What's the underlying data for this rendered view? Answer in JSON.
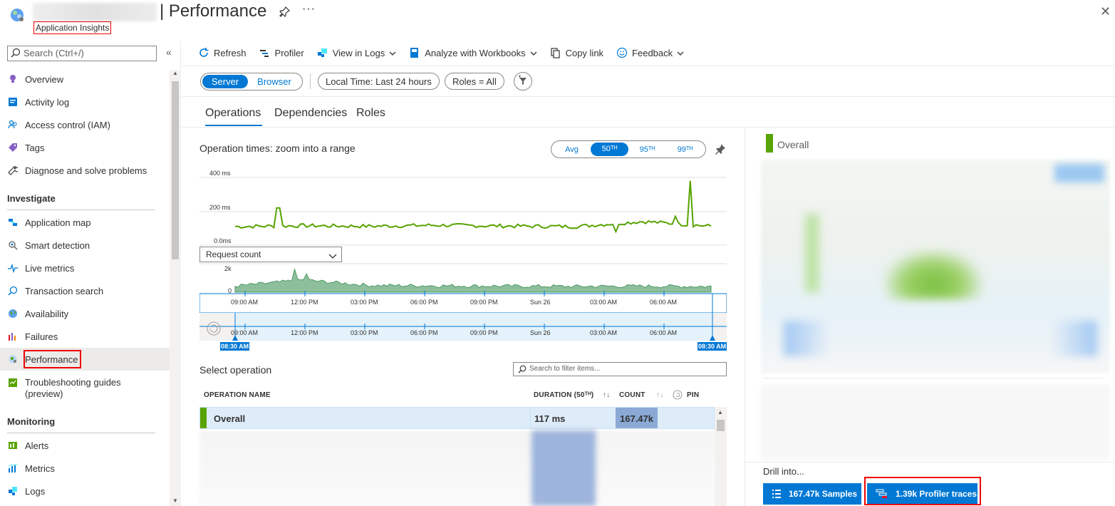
{
  "header": {
    "title": "| Performance",
    "subtitle": "Application Insights",
    "more_label": "···",
    "close_label": "✕"
  },
  "sidebar": {
    "search_placeholder": "Search (Ctrl+/)",
    "collapse_label": "«",
    "items_top": [
      {
        "label": "Overview",
        "icon": "lightbulb-icon"
      },
      {
        "label": "Activity log",
        "icon": "activity-log-icon"
      },
      {
        "label": "Access control (IAM)",
        "icon": "people-icon"
      },
      {
        "label": "Tags",
        "icon": "tag-icon"
      },
      {
        "label": "Diagnose and solve problems",
        "icon": "wrench-icon"
      }
    ],
    "section_investigate": "Investigate",
    "items_investigate": [
      {
        "label": "Application map",
        "icon": "app-map-icon"
      },
      {
        "label": "Smart detection",
        "icon": "smart-detection-icon"
      },
      {
        "label": "Live metrics",
        "icon": "pulse-icon"
      },
      {
        "label": "Transaction search",
        "icon": "search-icon"
      },
      {
        "label": "Availability",
        "icon": "globe-icon"
      },
      {
        "label": "Failures",
        "icon": "bar-chart-icon"
      },
      {
        "label": "Performance",
        "icon": "performance-icon"
      },
      {
        "label": "Troubleshooting guides\n(preview)",
        "icon": "guide-icon"
      }
    ],
    "section_monitoring": "Monitoring",
    "items_monitoring": [
      {
        "label": "Alerts",
        "icon": "alert-icon"
      },
      {
        "label": "Metrics",
        "icon": "metrics-icon"
      },
      {
        "label": "Logs",
        "icon": "logs-icon"
      }
    ]
  },
  "toolbar": {
    "refresh": "Refresh",
    "profiler": "Profiler",
    "view_in_logs": "View in Logs",
    "analyze_workbooks": "Analyze with Workbooks",
    "copy_link": "Copy link",
    "feedback": "Feedback"
  },
  "filters": {
    "server": "Server",
    "browser": "Browser",
    "time": "Local Time: Last 24 hours",
    "roles": "Roles = All"
  },
  "tabs": [
    "Operations",
    "Dependencies",
    "Roles"
  ],
  "chart": {
    "title": "Operation times: zoom into a range",
    "percentiles": [
      "Avg",
      "50ᵀᴴ",
      "95ᵀᴴ",
      "99ᵀᴴ"
    ],
    "selected_percentile": "50TH",
    "y_ticks": [
      "400 ms",
      "200 ms",
      "0.0ms"
    ],
    "count_select": "Request count",
    "count_ticks": [
      "2k",
      "0"
    ],
    "x_ticks": [
      "09:00 AM",
      "12:00 PM",
      "03:00 PM",
      "06:00 PM",
      "09:00 PM",
      "Sun 26",
      "03:00 AM",
      "06:00 AM"
    ],
    "range_start": "08:30 AM",
    "range_end": "08:30 AM",
    "line_color": "#57a300",
    "area_color": "#8dbf9d"
  },
  "chart_data": [
    {
      "type": "line",
      "title": "Operation times: zoom into a range",
      "ylabel": "",
      "ylim": [
        0,
        400
      ],
      "y_unit": "ms",
      "x": [
        "09:00 AM",
        "12:00 PM",
        "03:00 PM",
        "06:00 PM",
        "09:00 PM",
        "Sun 26",
        "03:00 AM",
        "06:00 AM"
      ],
      "values": [
        110,
        115,
        112,
        118,
        113,
        110,
        140,
        112
      ]
    },
    {
      "type": "area",
      "ylim": [
        0,
        2000
      ],
      "x": [
        "09:00 AM",
        "12:00 PM",
        "03:00 PM",
        "06:00 PM",
        "09:00 PM",
        "Sun 26",
        "03:00 AM",
        "06:00 AM"
      ],
      "values": [
        450,
        900,
        500,
        480,
        450,
        430,
        450,
        420
      ]
    }
  ],
  "operations": {
    "section_title": "Select operation",
    "filter_placeholder": "Search to filter items...",
    "columns": {
      "name": "OPERATION NAME",
      "duration": "DURATION (50ᵀᴴ)",
      "count": "COUNT",
      "pin": "PIN",
      "sort": "↑↓"
    },
    "rows": [
      {
        "name": "Overall",
        "duration": "117 ms",
        "count": "167.47k"
      }
    ]
  },
  "right_panel": {
    "title": "Overall",
    "drill_label": "Drill into...",
    "samples_button": "167.47k Samples",
    "profiler_button": "1.39k Profiler traces"
  }
}
